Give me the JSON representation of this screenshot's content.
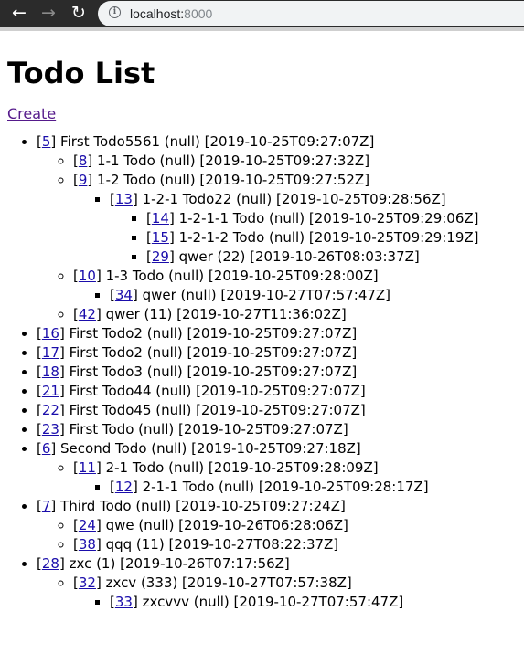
{
  "browser": {
    "url_host": "localhost:",
    "url_port": "8000",
    "back_icon": "arrow-left-icon",
    "forward_icon": "arrow-right-icon",
    "reload_icon": "reload-icon",
    "info_icon": "info-icon"
  },
  "page": {
    "title": "Todo List",
    "create_label": "Create"
  },
  "todos": [
    {
      "id": "5",
      "text": "First Todo5561 (null) [2019-10-25T09:27:07Z]",
      "children": [
        {
          "id": "8",
          "text": "1-1 Todo (null) [2019-10-25T09:27:32Z]"
        },
        {
          "id": "9",
          "text": "1-2 Todo (null) [2019-10-25T09:27:52Z]",
          "children": [
            {
              "id": "13",
              "text": "1-2-1 Todo22 (null) [2019-10-25T09:28:56Z]",
              "children": [
                {
                  "id": "14",
                  "text": "1-2-1-1 Todo (null) [2019-10-25T09:29:06Z]"
                },
                {
                  "id": "15",
                  "text": "1-2-1-2 Todo (null) [2019-10-25T09:29:19Z]"
                },
                {
                  "id": "29",
                  "text": "qwer (22) [2019-10-26T08:03:37Z]"
                }
              ]
            }
          ]
        },
        {
          "id": "10",
          "text": "1-3 Todo (null) [2019-10-25T09:28:00Z]",
          "children": [
            {
              "id": "34",
              "text": "qwer (null) [2019-10-27T07:57:47Z]"
            }
          ]
        },
        {
          "id": "42",
          "text": "qwer (11) [2019-10-27T11:36:02Z]"
        }
      ]
    },
    {
      "id": "16",
      "text": "First Todo2 (null) [2019-10-25T09:27:07Z]"
    },
    {
      "id": "17",
      "text": "First Todo2 (null) [2019-10-25T09:27:07Z]"
    },
    {
      "id": "18",
      "text": "First Todo3 (null) [2019-10-25T09:27:07Z]"
    },
    {
      "id": "21",
      "text": "First Todo44 (null) [2019-10-25T09:27:07Z]"
    },
    {
      "id": "22",
      "text": "First Todo45 (null) [2019-10-25T09:27:07Z]"
    },
    {
      "id": "23",
      "text": "First Todo (null) [2019-10-25T09:27:07Z]"
    },
    {
      "id": "6",
      "text": "Second Todo (null) [2019-10-25T09:27:18Z]",
      "children": [
        {
          "id": "11",
          "text": "2-1 Todo (null) [2019-10-25T09:28:09Z]",
          "children": [
            {
              "id": "12",
              "text": "2-1-1 Todo (null) [2019-10-25T09:28:17Z]"
            }
          ]
        }
      ]
    },
    {
      "id": "7",
      "text": "Third Todo (null) [2019-10-25T09:27:24Z]",
      "children": [
        {
          "id": "24",
          "text": "qwe (null) [2019-10-26T06:28:06Z]"
        },
        {
          "id": "38",
          "text": "qqq (11) [2019-10-27T08:22:37Z]"
        }
      ]
    },
    {
      "id": "28",
      "text": "zxc (1) [2019-10-26T07:17:56Z]",
      "children": [
        {
          "id": "32",
          "text": "zxcv (333) [2019-10-27T07:57:38Z]",
          "children": [
            {
              "id": "33",
              "text": "zxcvvv (null) [2019-10-27T07:57:47Z]"
            }
          ]
        }
      ]
    }
  ]
}
